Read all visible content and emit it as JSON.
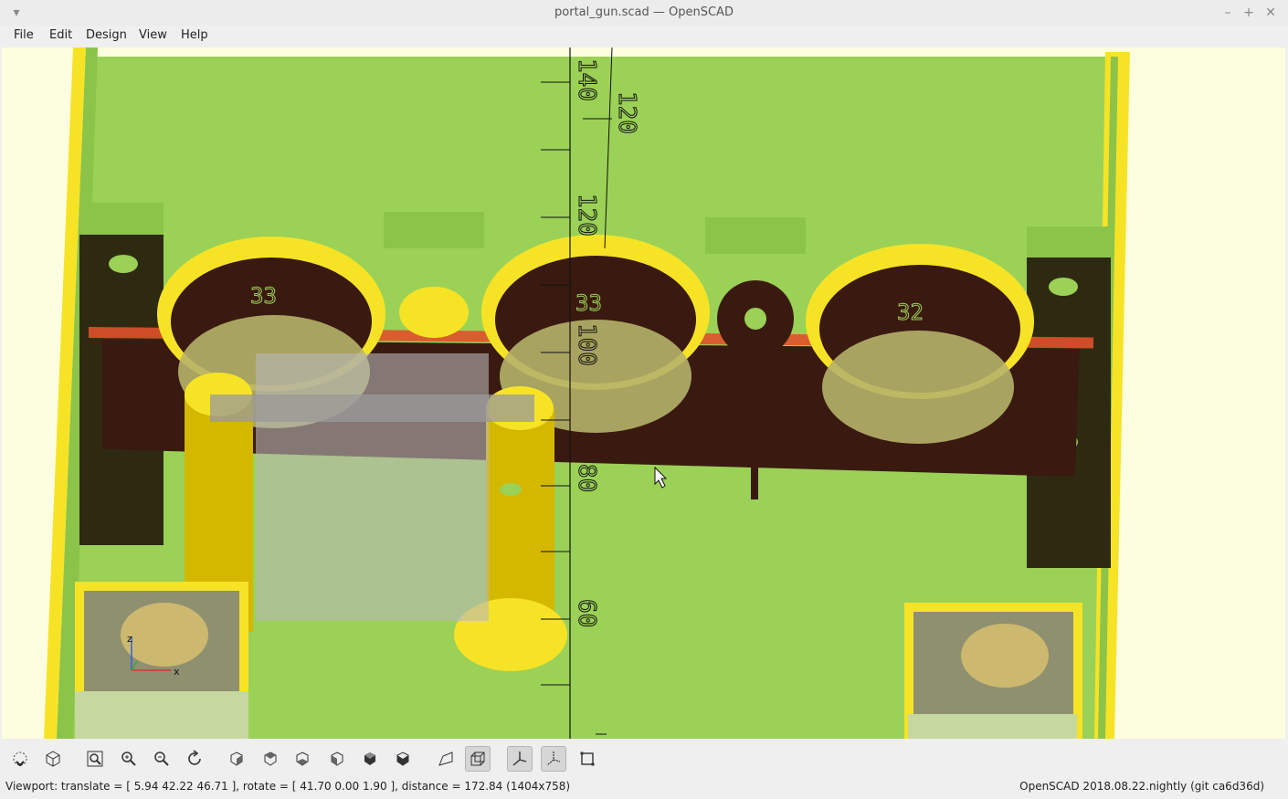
{
  "window": {
    "title": "portal_gun.scad — OpenSCAD",
    "menu_icon": "chevron-down-icon",
    "controls": [
      "minimize-icon",
      "maximize-icon",
      "close-icon"
    ]
  },
  "menubar": {
    "items": [
      "File",
      "Edit",
      "Design",
      "View",
      "Help"
    ]
  },
  "viewport": {
    "background_color": "#fdfde0",
    "model_colors": {
      "face": "#9bd156",
      "yellow": "#f7e326",
      "dark": "#3a1a10",
      "rim": "#e0502a"
    },
    "gear_labels": [
      "33",
      "33",
      "32"
    ],
    "axis_tick_labels": [
      "140",
      "120",
      "120",
      "100",
      "80",
      "60"
    ],
    "orientation_axes": {
      "x": "x",
      "z": "z"
    }
  },
  "toolbar": {
    "buttons": [
      {
        "name": "preview-button",
        "icon": "preview-icon"
      },
      {
        "name": "render-button",
        "icon": "render-icon"
      },
      {
        "name": "view-all-button",
        "icon": "view-all-icon"
      },
      {
        "name": "zoom-in-button",
        "icon": "zoom-in-icon"
      },
      {
        "name": "zoom-out-button",
        "icon": "zoom-out-icon"
      },
      {
        "name": "reset-view-button",
        "icon": "reset-view-icon"
      },
      {
        "name": "view-right-button",
        "icon": "view-right-icon"
      },
      {
        "name": "view-top-button",
        "icon": "view-top-icon"
      },
      {
        "name": "view-bottom-button",
        "icon": "view-bottom-icon"
      },
      {
        "name": "view-left-button",
        "icon": "view-left-icon"
      },
      {
        "name": "view-front-button",
        "icon": "view-front-icon"
      },
      {
        "name": "view-back-button",
        "icon": "view-back-icon"
      },
      {
        "name": "perspective-button",
        "icon": "perspective-icon"
      },
      {
        "name": "orthogonal-button",
        "icon": "orthogonal-icon",
        "active": true
      },
      {
        "name": "show-axes-button",
        "icon": "show-axes-icon",
        "active": true
      },
      {
        "name": "show-scale-markers-button",
        "icon": "scale-markers-icon",
        "active": true
      },
      {
        "name": "show-edges-button",
        "icon": "show-edges-icon"
      }
    ]
  },
  "statusbar": {
    "viewport_info": "Viewport: translate = [ 5.94 42.22 46.71 ], rotate = [ 41.70 0.00 1.90 ], distance = 172.84 (1404x758)",
    "version": "OpenSCAD 2018.08.22.nightly (git ca6d36d)"
  }
}
